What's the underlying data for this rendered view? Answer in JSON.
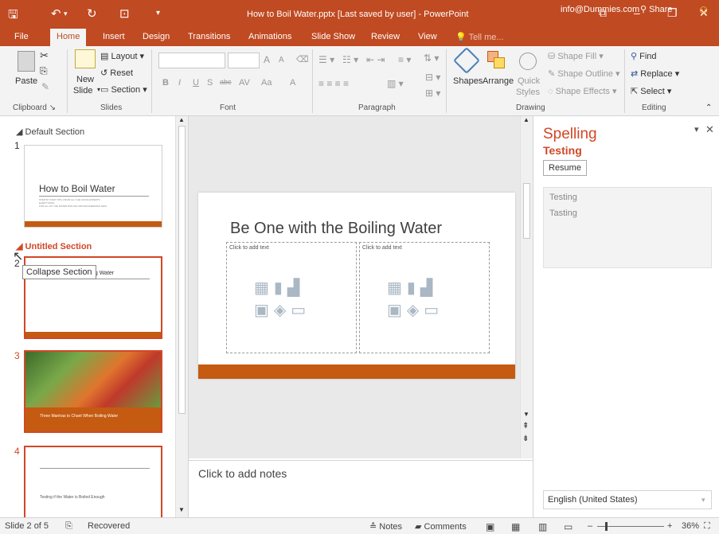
{
  "window": {
    "title": "How to Boil Water.pptx [Last saved by user] - PowerPoint",
    "account": "info@Dummies.com",
    "share_label": "Share"
  },
  "tabs": [
    "File",
    "Home",
    "Insert",
    "Design",
    "Transitions",
    "Animations",
    "Slide Show",
    "Review",
    "View"
  ],
  "tell_me": "Tell me...",
  "ribbon": {
    "clipboard": {
      "paste": "Paste",
      "label": "Clipboard"
    },
    "slides": {
      "new_slide_1": "New",
      "new_slide_2": "Slide",
      "layout": "Layout",
      "reset": "Reset",
      "section": "Section",
      "label": "Slides"
    },
    "font": {
      "bold": "B",
      "italic": "I",
      "underline": "U",
      "shadow": "S",
      "strike": "abc",
      "spacing": "AV",
      "case": "Aa",
      "color": "A",
      "grow": "A",
      "shrink": "A",
      "label": "Font"
    },
    "paragraph": {
      "label": "Paragraph"
    },
    "drawing": {
      "shapes": "Shapes",
      "arrange": "Arrange",
      "quick_1": "Quick",
      "quick_2": "Styles",
      "fill": "Shape Fill",
      "outline": "Shape Outline",
      "effects": "Shape Effects",
      "label": "Drawing"
    },
    "editing": {
      "find": "Find",
      "replace": "Replace",
      "select": "Select",
      "label": "Editing"
    }
  },
  "thumbnails": {
    "default_section": "Default Section",
    "untitled_section": "Untitled Section",
    "tooltip": "Collapse Section",
    "slides": [
      {
        "num": "1",
        "title": "How to Boil Water",
        "sub1": "STEP BY STEP TIPS, FROM ALL THE GOOD EXPERTS",
        "sub2": "EVERYTHING",
        "sub3": "FOR ALL OF THE WATER BOILING AND ENGINEERING NEW"
      },
      {
        "num": "2",
        "title": "Be One with the Boiling Water"
      },
      {
        "num": "3",
        "caption": "Three Mantras to Chant When Boiling Water"
      },
      {
        "num": "4",
        "caption": "Testing if the Water is Boiled Enough"
      }
    ]
  },
  "slide": {
    "title": "Be One with the Boiling Water",
    "placeholder_left": "Click to add text",
    "placeholder_right": "Click to add text"
  },
  "notes_placeholder": "Click to add notes",
  "spelling": {
    "heading": "Spelling",
    "word": "Testing",
    "resume": "Resume",
    "suggestions": [
      "Testing",
      "Tasting"
    ],
    "language": "English (United States)"
  },
  "status": {
    "slide_count": "Slide 2 of 5",
    "recovered": "Recovered",
    "notes": "Notes",
    "comments": "Comments",
    "zoom": "36%"
  },
  "colors": {
    "accent": "#c04a22",
    "slide_bar": "#c55a11",
    "selection": "#d24726"
  }
}
